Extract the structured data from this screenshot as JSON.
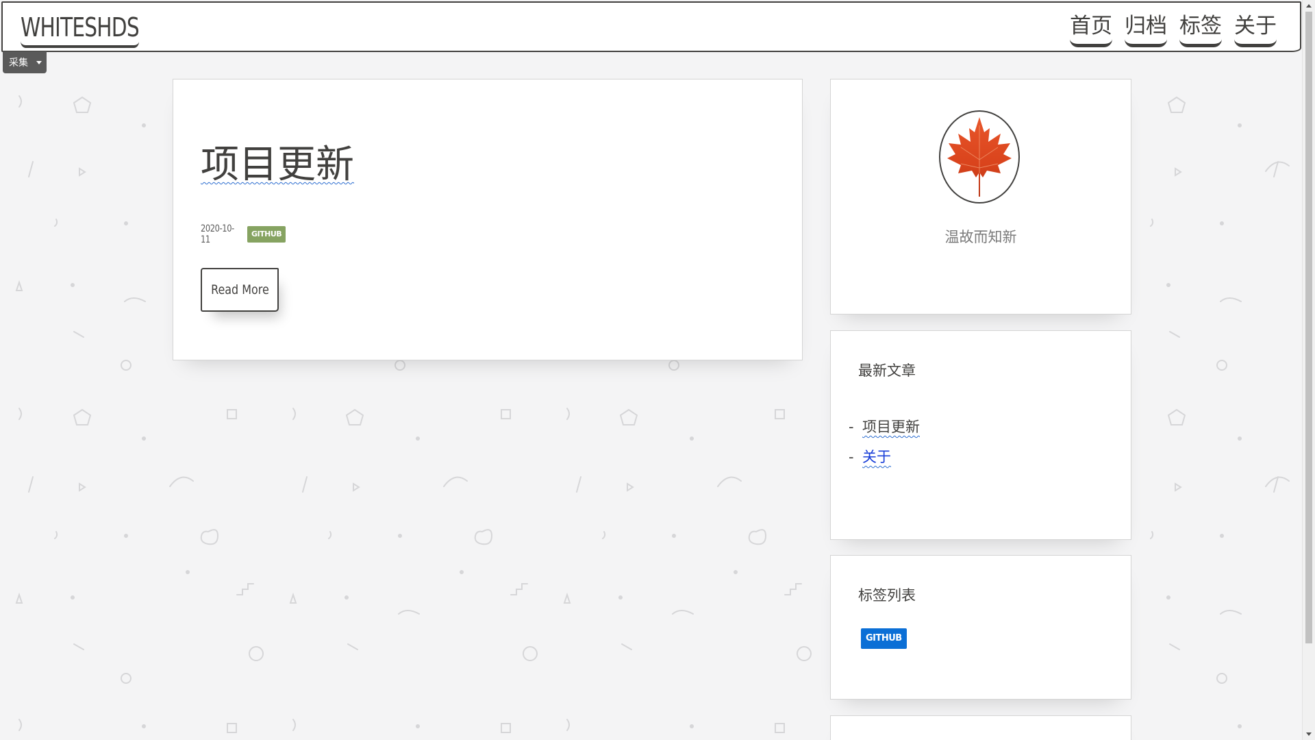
{
  "header": {
    "logo": "WHITESHDS",
    "nav": [
      {
        "label": "首页"
      },
      {
        "label": "归档"
      },
      {
        "label": "标签"
      },
      {
        "label": "关于"
      }
    ]
  },
  "collect_widget": {
    "label": "采集"
  },
  "post": {
    "title": "项目更新",
    "date": "2020-10-11",
    "tag": "GITHUB",
    "read_more_label": "Read More"
  },
  "profile": {
    "motto": "温故而知新"
  },
  "recent_posts": {
    "title": "最新文章",
    "items": [
      {
        "dash": "-",
        "label": "项目更新"
      },
      {
        "dash": "-",
        "label": "关于"
      }
    ]
  },
  "tags_widget": {
    "title": "标签列表",
    "tags": [
      {
        "label": "GITHUB"
      }
    ]
  },
  "colors": {
    "text": "#41403e",
    "post_tag": "#86a361",
    "tag_chip": "#0b6fd6",
    "link_visited": "#1a3fd8",
    "wavy_underline": "#2b6cd0"
  }
}
